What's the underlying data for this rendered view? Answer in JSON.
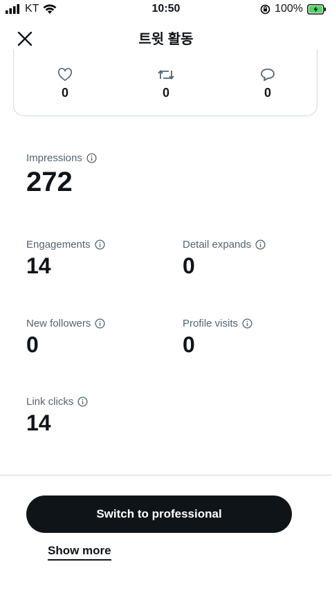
{
  "status_bar": {
    "carrier": "KT",
    "time": "10:50",
    "battery_percent": "100%",
    "signal_icon": "signal-bars-icon",
    "wifi_icon": "wifi-icon",
    "orientation_icon": "orientation-lock-icon",
    "battery_icon": "battery-charging-icon",
    "battery_color": "#4cd964"
  },
  "header": {
    "title": "트윗 활동",
    "close_icon": "close-icon"
  },
  "engagement_row": {
    "likes": "0",
    "retweets": "0",
    "replies": "0"
  },
  "metrics": {
    "impressions": {
      "label": "Impressions",
      "value": "272"
    },
    "engagements": {
      "label": "Engagements",
      "value": "14"
    },
    "detail_expands": {
      "label": "Detail expands",
      "value": "0"
    },
    "new_followers": {
      "label": "New followers",
      "value": "0"
    },
    "profile_visits": {
      "label": "Profile visits",
      "value": "0"
    },
    "link_clicks": {
      "label": "Link clicks",
      "value": "14"
    }
  },
  "actions": {
    "switch_label": "Switch to professional",
    "show_more_label": "Show more"
  },
  "colors": {
    "text_primary": "#0f1419",
    "text_secondary": "#536471",
    "border": "#cfd9de",
    "button_bg": "#0f1419"
  }
}
